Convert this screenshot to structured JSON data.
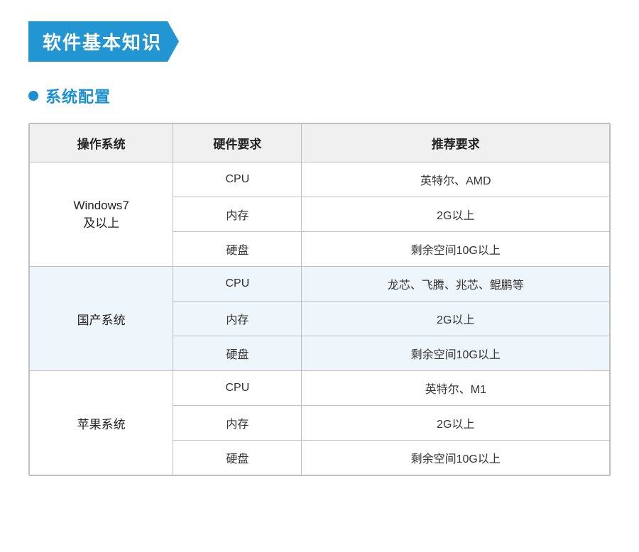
{
  "page": {
    "title": "软件基本知识",
    "section": {
      "label": "系统配置"
    },
    "table": {
      "headers": [
        "操作系统",
        "硬件要求",
        "推荐要求"
      ],
      "groups": [
        {
          "os": "Windows7\n及以上",
          "rows": [
            {
              "hw": "CPU",
              "rec": "英特尔、AMD"
            },
            {
              "hw": "内存",
              "rec": "2G以上"
            },
            {
              "hw": "硬盘",
              "rec": "剩余空间10G以上"
            }
          ]
        },
        {
          "os": "国产系统",
          "rows": [
            {
              "hw": "CPU",
              "rec": "龙芯、飞腾、兆芯、鲲鹏等"
            },
            {
              "hw": "内存",
              "rec": "2G以上"
            },
            {
              "hw": "硬盘",
              "rec": "剩余空间10G以上"
            }
          ]
        },
        {
          "os": "苹果系统",
          "rows": [
            {
              "hw": "CPU",
              "rec": "英特尔、M1"
            },
            {
              "hw": "内存",
              "rec": "2G以上"
            },
            {
              "hw": "硬盘",
              "rec": "剩余空间10G以上"
            }
          ]
        }
      ]
    }
  }
}
